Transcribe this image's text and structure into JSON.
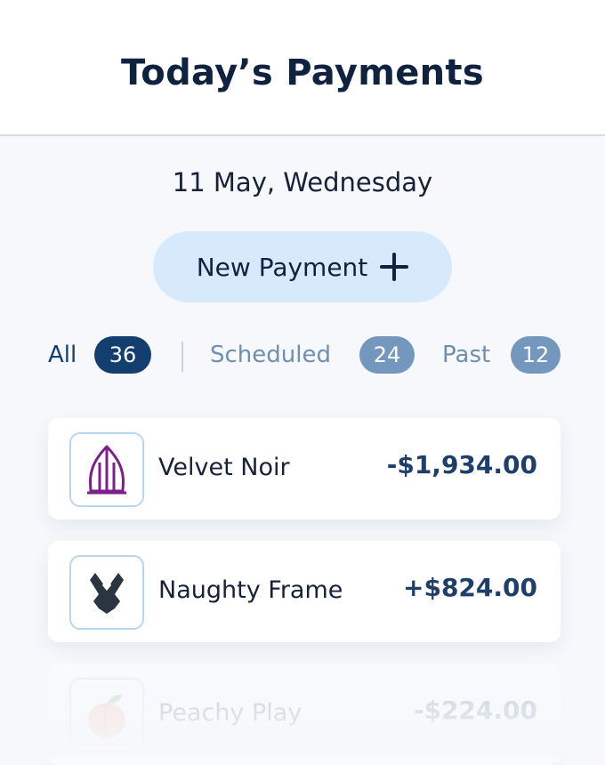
{
  "header": {
    "title": "Today’s Payments"
  },
  "date_label": "11 May, Wednesday",
  "new_payment": {
    "label": "New Payment",
    "icon": "plus-icon"
  },
  "filters": [
    {
      "label": "All",
      "count": "36",
      "active": true
    },
    {
      "label": "Scheduled",
      "count": "24",
      "active": false
    },
    {
      "label": "Past",
      "count": "12",
      "active": false
    }
  ],
  "payments": [
    {
      "name": "Velvet Noir",
      "amount": "-$1,934.00",
      "icon": "velvet-noir-logo"
    },
    {
      "name": "Naughty Frame",
      "amount": "+$824.00",
      "icon": "naughty-frame-logo"
    },
    {
      "name": "Peachy Play",
      "amount": "-$224.00",
      "icon": "peach-logo"
    }
  ],
  "colors": {
    "primary": "#0f2340",
    "accent_light": "#d7eafc",
    "badge_active": "#133e70",
    "badge_inactive": "#7397bd",
    "muted_text": "#6f8fb2"
  }
}
